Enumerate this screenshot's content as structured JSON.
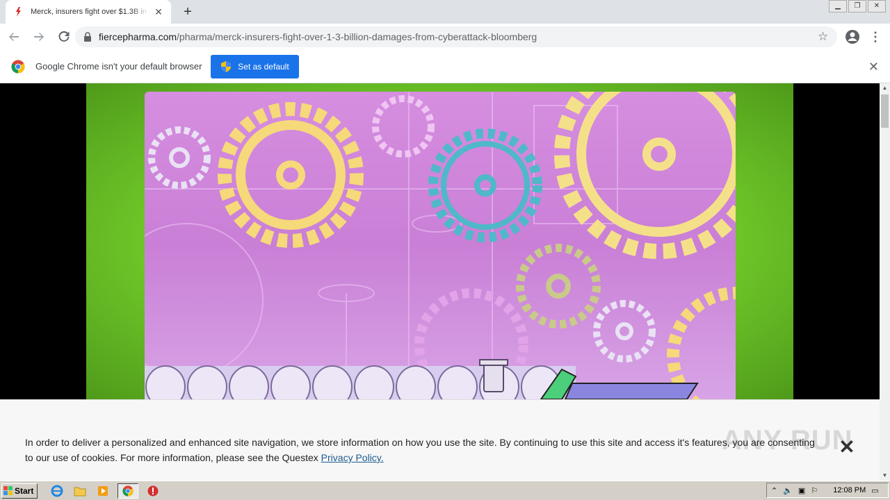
{
  "browser": {
    "tab_title": "Merck, insurers fight over $1.3B in d",
    "url_host": "fiercepharma.com",
    "url_path": "/pharma/merck-insurers-fight-over-1-3-billion-damages-from-cyberattack-bloomberg",
    "new_tab_label": "+",
    "close_tab_label": "✕"
  },
  "infobar": {
    "message": "Google Chrome isn't your default browser",
    "button_label": "Set as default",
    "close_label": "✕"
  },
  "cookie_banner": {
    "text": "In order to deliver a personalized and enhanced site navigation, we store information on how you use the site. By continuing to use this site and access it's features, you are consenting to our use of cookies. For more information, please see the Questex ",
    "link_text": "Privacy Policy.",
    "close_label": "✕",
    "watermark": "ANY RUN"
  },
  "taskbar": {
    "start_label": "Start",
    "clock": "12:08 PM"
  },
  "colors": {
    "accent": "#1a73e8",
    "frame_green": "#6cc428",
    "scene_pink": "#c97fd6",
    "gear_yellow": "#f5d97a",
    "gear_teal": "#4fb8c9"
  }
}
